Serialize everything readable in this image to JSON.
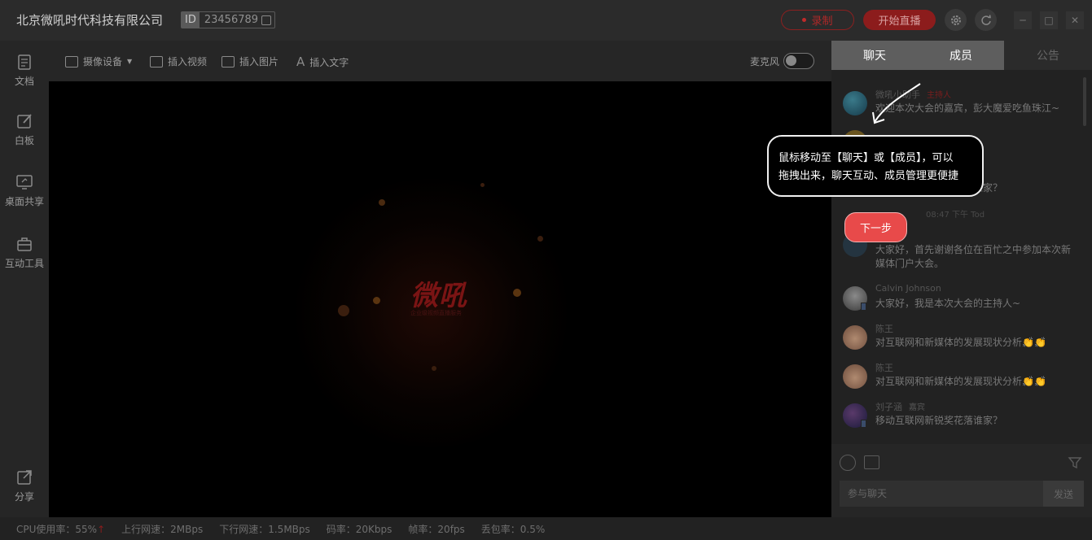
{
  "app": {
    "title": "北京微吼时代科技有限公司",
    "id_tag": "ID",
    "id_value": "23456789",
    "record_label": "录制",
    "live_label": "开始直播"
  },
  "sidebar": {
    "items": [
      {
        "label": "文档",
        "icon": "document-icon"
      },
      {
        "label": "白板",
        "icon": "whiteboard-icon"
      },
      {
        "label": "桌面共享",
        "icon": "desktop-share-icon"
      },
      {
        "label": "互动工具",
        "icon": "toolbox-icon"
      }
    ],
    "share_label": "分享"
  },
  "toolbar": {
    "camera_label": "摄像设备",
    "insert_video_label": "插入视频",
    "insert_image_label": "插入图片",
    "insert_text_label": "插入文字",
    "mic_label": "麦克风",
    "mic_on": false
  },
  "stage": {
    "logo_text": "微吼",
    "logo_sub": "企业级视频直播服务"
  },
  "right_panel": {
    "tabs": [
      "聊天",
      "成员",
      "公告"
    ],
    "messages": [
      {
        "name": "微吼小助手",
        "tag": "主持人",
        "text": "欢迎本次大会的嘉宾，彭大魔爱吃鱼珠江~"
      },
      {
        "name": "",
        "tag": "",
        "text": "大家好!"
      },
      {
        "name": "",
        "tag": "",
        "text": "移动互联网新锐奖花落谁家？"
      },
      {
        "name": "",
        "tag": "",
        "text": "大家好，首先谢谢各位在百忙之中参加本次新媒体门户大会。"
      },
      {
        "name": "Calvin Johnson",
        "tag": "",
        "text": "大家好，我是本次大会的主持人~"
      },
      {
        "name": "陈王",
        "tag": "",
        "text": "对互联网和新媒体的发展现状分析👏👏"
      },
      {
        "name": "陈王",
        "tag": "",
        "text": "对互联网和新媒体的发展现状分析👏👏"
      },
      {
        "name": "刘子涵",
        "tag": "嘉宾",
        "text": "移动互联网新锐奖花落谁家？"
      }
    ],
    "time_label": "08:47 下午 Tod",
    "input_placeholder": "参与聊天",
    "send_label": "发送"
  },
  "status": {
    "cpu": "CPU使用率：55%",
    "cpu_arrow": "↑",
    "upload_speed": "上行网速：2MBps",
    "download_speed": "下行网速：1.5MBps",
    "bitrate": "码率：20Kbps",
    "framerate": "帧率：20fps",
    "packet_loss": "丢包率：0.5%"
  },
  "guide": {
    "tooltip_line1": "鼠标移动至【聊天】或【成员】，可以",
    "tooltip_line2": "拖拽出来，聊天互动、成员管理更便捷",
    "next_label": "下一步"
  },
  "colors": {
    "accent": "#e84a4a",
    "record_red": "#8b2020",
    "highlight_tab": "#5e5e5e"
  }
}
